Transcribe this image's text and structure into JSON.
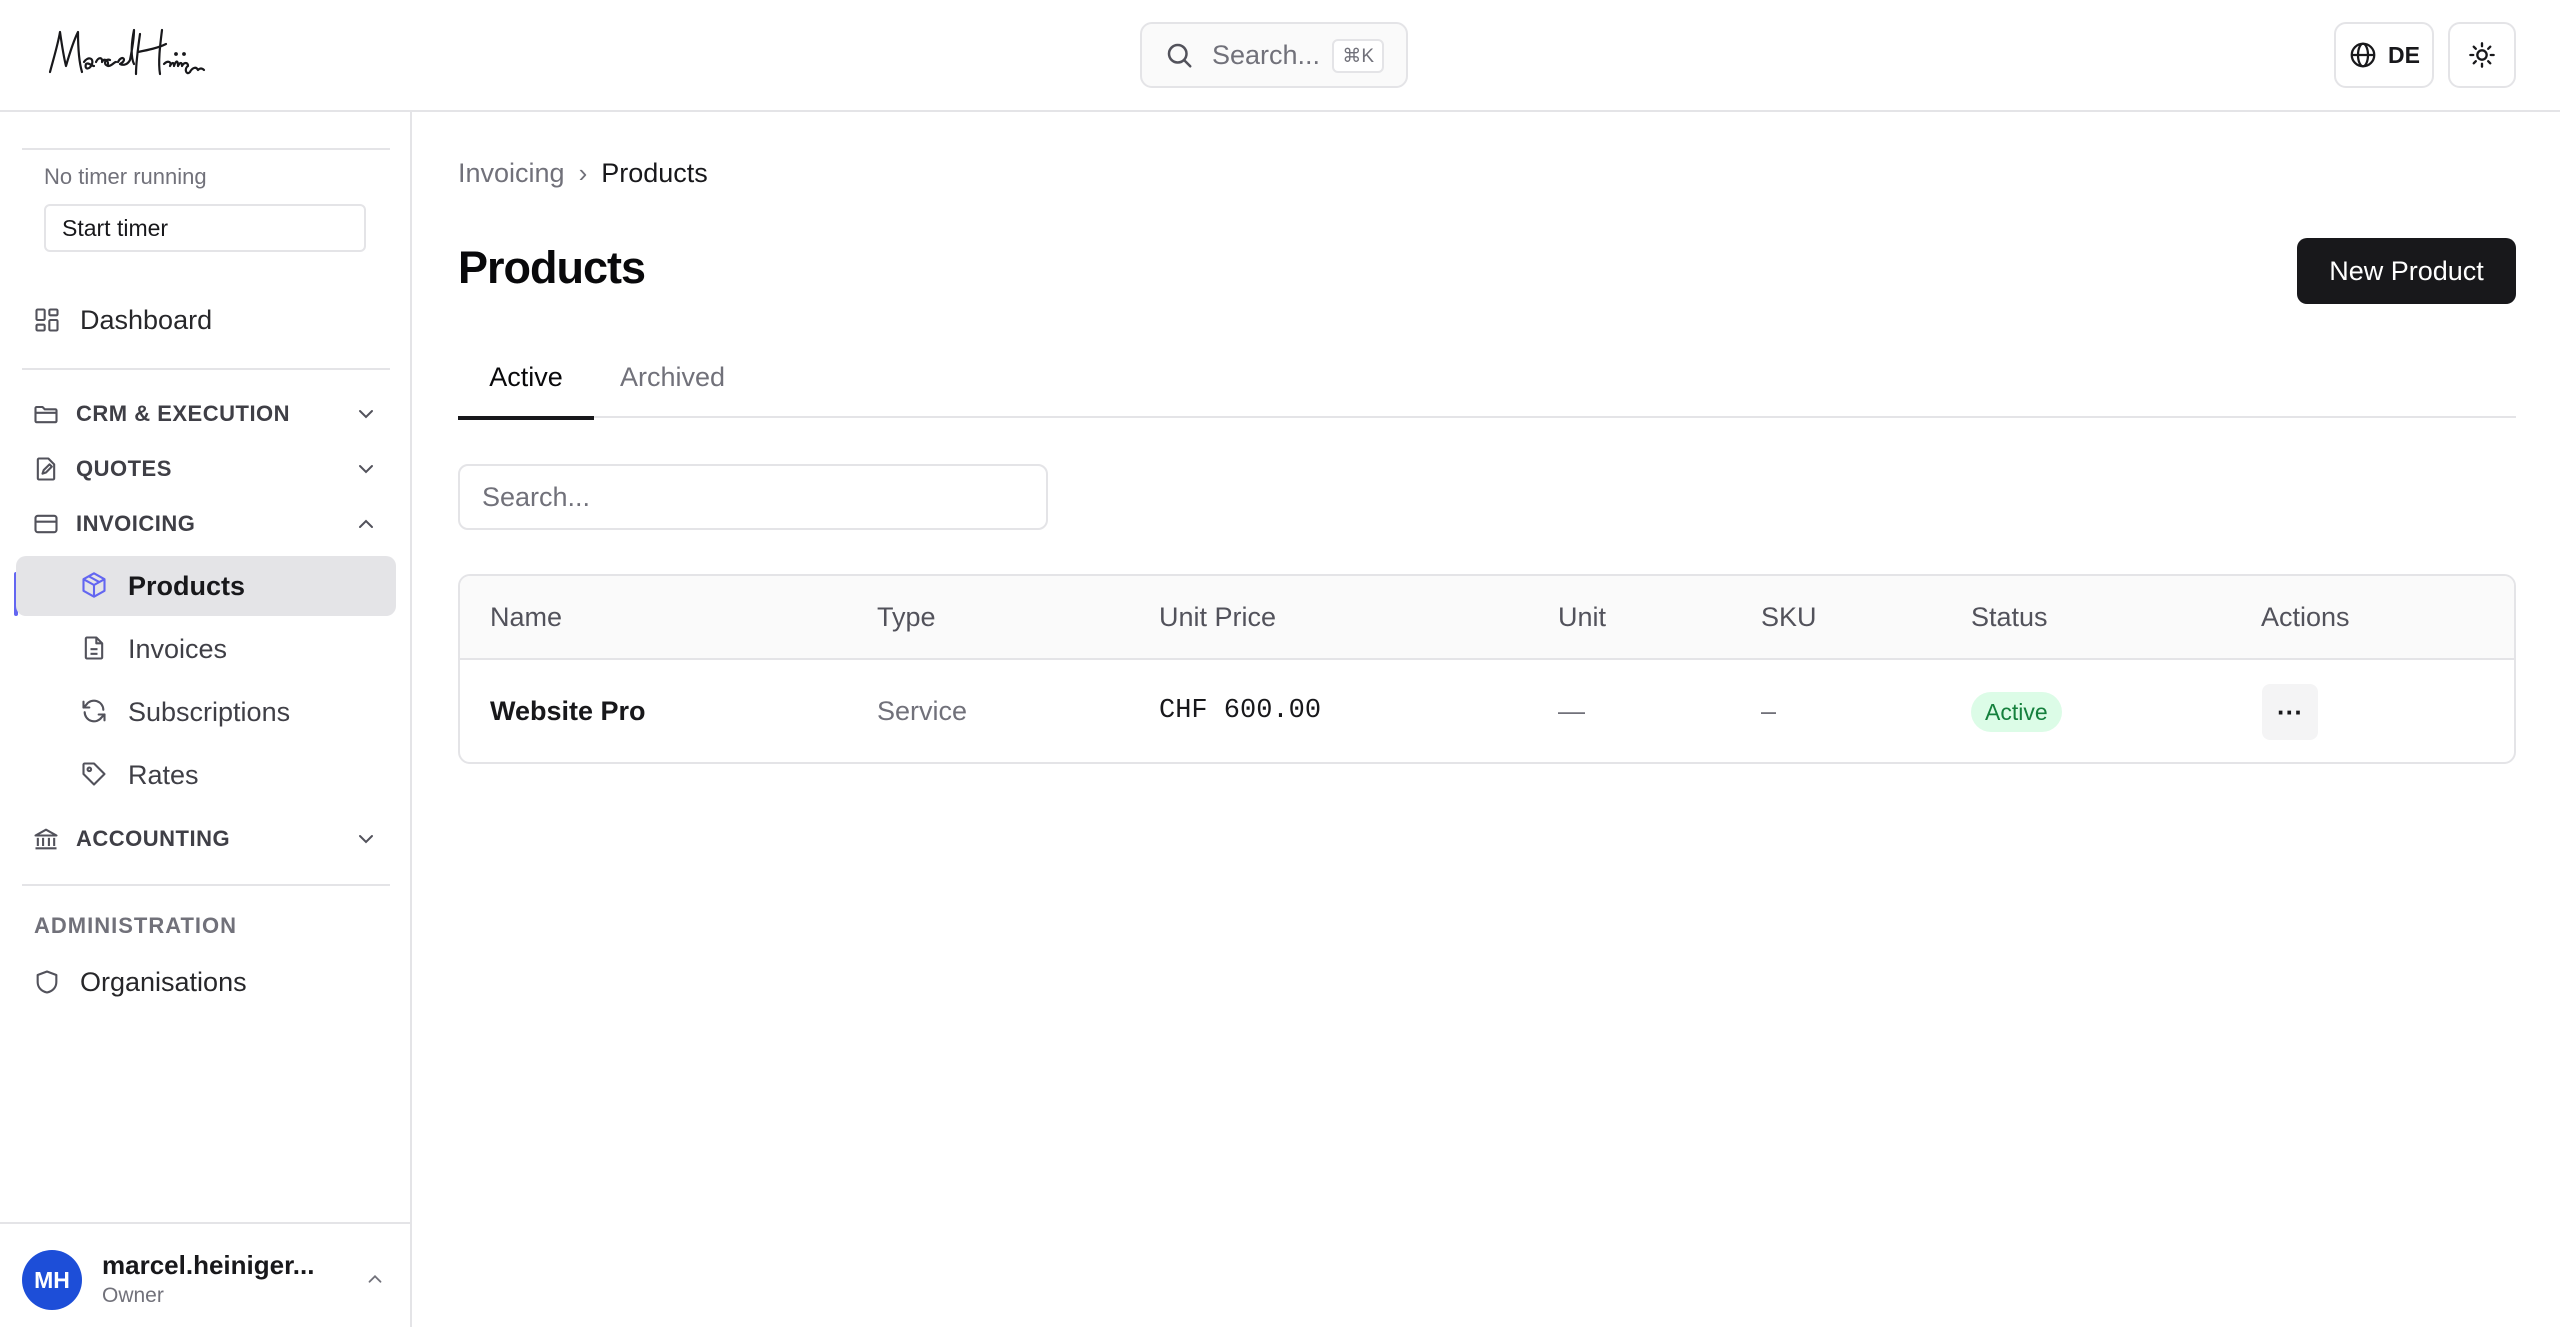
{
  "header": {
    "search_label": "Search...",
    "search_shortcut": "⌘K",
    "language": "DE"
  },
  "sidebar": {
    "timer": {
      "status": "No timer running",
      "button": "Start timer"
    },
    "dashboard": "Dashboard",
    "sections": {
      "crm": "CRM & EXECUTION",
      "quotes": "QUOTES",
      "invoicing": "INVOICING",
      "accounting": "ACCOUNTING"
    },
    "invoicing_items": [
      "Products",
      "Invoices",
      "Subscriptions",
      "Rates"
    ],
    "administration_label": "ADMINISTRATION",
    "organisations": "Organisations",
    "user": {
      "initials": "MH",
      "name": "marcel.heiniger...",
      "role": "Owner"
    }
  },
  "main": {
    "breadcrumb": {
      "parent": "Invoicing",
      "separator": "›",
      "current": "Products"
    },
    "title": "Products",
    "new_button": "New Product",
    "tabs": [
      "Active",
      "Archived"
    ],
    "search_placeholder": "Search...",
    "table": {
      "columns": [
        "Name",
        "Type",
        "Unit Price",
        "Unit",
        "SKU",
        "Status",
        "Actions"
      ],
      "rows": [
        {
          "name": "Website Pro",
          "type": "Service",
          "unit_price": "CHF 600.00",
          "unit": "—",
          "sku": "–",
          "status": "Active",
          "actions": "···"
        }
      ]
    }
  },
  "colors": {
    "accent": "#6366f1",
    "primary_button": "#18181b",
    "avatar": "#1d4ed8",
    "status_active_bg": "#dcfce7",
    "status_active_text": "#15803d"
  }
}
